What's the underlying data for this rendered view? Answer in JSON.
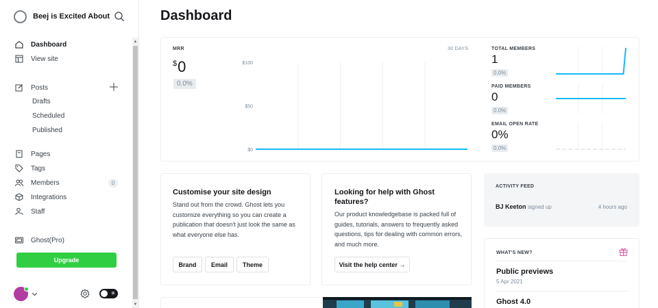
{
  "sidebar": {
    "site_name": "Beej is Excited About ...",
    "nav_primary": [
      {
        "label": "Dashboard",
        "icon": "home-icon"
      },
      {
        "label": "View site",
        "icon": "layout-icon"
      }
    ],
    "posts": {
      "label": "Posts",
      "icon": "pencil-icon"
    },
    "posts_sub": [
      "Drafts",
      "Scheduled",
      "Published"
    ],
    "nav_secondary": [
      {
        "label": "Pages",
        "icon": "page-icon"
      },
      {
        "label": "Tags",
        "icon": "tag-icon"
      },
      {
        "label": "Members",
        "icon": "members-icon",
        "badge": "0"
      },
      {
        "label": "Integrations",
        "icon": "box-icon"
      },
      {
        "label": "Staff",
        "icon": "staff-icon"
      }
    ],
    "ghost_pro": {
      "label": "Ghost(Pro)",
      "icon": "ghost-pro-icon"
    },
    "upgrade_label": "Upgrade",
    "accent": "#30cf43"
  },
  "main": {
    "title": "Dashboard",
    "mrr": {
      "label": "MRR",
      "currency": "$",
      "value": "0",
      "delta": "0.0%",
      "range": "30 DAYS"
    },
    "metrics": [
      {
        "label": "TOTAL MEMBERS",
        "value": "1",
        "delta": "0.0%"
      },
      {
        "label": "PAID MEMBERS",
        "value": "0",
        "delta": "0.0%"
      },
      {
        "label": "EMAIL OPEN RATE",
        "value": "0%",
        "delta": "0.0%"
      }
    ],
    "customise": {
      "title": "Customise your site design",
      "text": "Stand out from the crowd. Ghost lets you customize everything so you can create a publication that doesn't just look the same as what everyone else has.",
      "buttons": [
        "Brand",
        "Email",
        "Theme"
      ]
    },
    "help": {
      "title": "Looking for help with Ghost features?",
      "text": "Our product knowledgebase is packed full of guides, tutorials, answers to frequently asked questions, tips for dealing with common errors, and much more.",
      "button": "Visit the help center →"
    },
    "activity": {
      "label": "ACTIVITY FEED",
      "name": "BJ Keeton",
      "action": "signed up",
      "time": "4 hours ago"
    },
    "whats_new": {
      "label": "WHAT'S NEW?",
      "items": [
        {
          "title": "Public previews",
          "date": "5 Apr 2021"
        },
        {
          "title": "Ghost 4.0"
        }
      ]
    }
  },
  "chart_data": [
    {
      "type": "line",
      "title": "MRR",
      "y_ticks": [
        "$100",
        "$50",
        "$0"
      ],
      "ylim": [
        0,
        100
      ],
      "series": [
        {
          "values": [
            0,
            0,
            0,
            0,
            0,
            0,
            0,
            0,
            0,
            0,
            0,
            0,
            0,
            0,
            0,
            0,
            0,
            0,
            0,
            0,
            0,
            0,
            0,
            0,
            0,
            0,
            0,
            0,
            0,
            0
          ]
        }
      ],
      "grid": "vertical",
      "color": "#14b8ff"
    },
    {
      "type": "line",
      "title": "TOTAL MEMBERS",
      "series": [
        {
          "values": [
            0,
            0,
            0,
            0,
            0,
            0,
            0,
            0,
            0,
            0,
            0,
            0,
            0,
            0,
            0,
            0,
            0,
            0,
            0,
            0,
            0,
            0,
            0,
            0,
            0,
            0,
            0,
            0,
            0,
            1
          ]
        }
      ],
      "ylim": [
        0,
        1
      ],
      "color": "#14b8ff"
    },
    {
      "type": "line",
      "title": "PAID MEMBERS",
      "series": [
        {
          "values": [
            0,
            0,
            0,
            0,
            0,
            0,
            0,
            0,
            0,
            0,
            0,
            0,
            0,
            0,
            0,
            0,
            0,
            0,
            0,
            0,
            0,
            0,
            0,
            0,
            0,
            0,
            0,
            0,
            0,
            0
          ]
        }
      ],
      "ylim": [
        0,
        0
      ],
      "color": "#14b8ff"
    },
    {
      "type": "line",
      "title": "EMAIL OPEN RATE",
      "series": [
        {
          "values": [
            0,
            0,
            0,
            0,
            0,
            0,
            0,
            0,
            0,
            0,
            0,
            0,
            0,
            0,
            0,
            0,
            0,
            0,
            0,
            0,
            0,
            0,
            0,
            0,
            0,
            0,
            0,
            0,
            0,
            0
          ]
        }
      ],
      "ylim": [
        0,
        100
      ],
      "style": "dashed",
      "color": "#dfe3e6"
    }
  ]
}
